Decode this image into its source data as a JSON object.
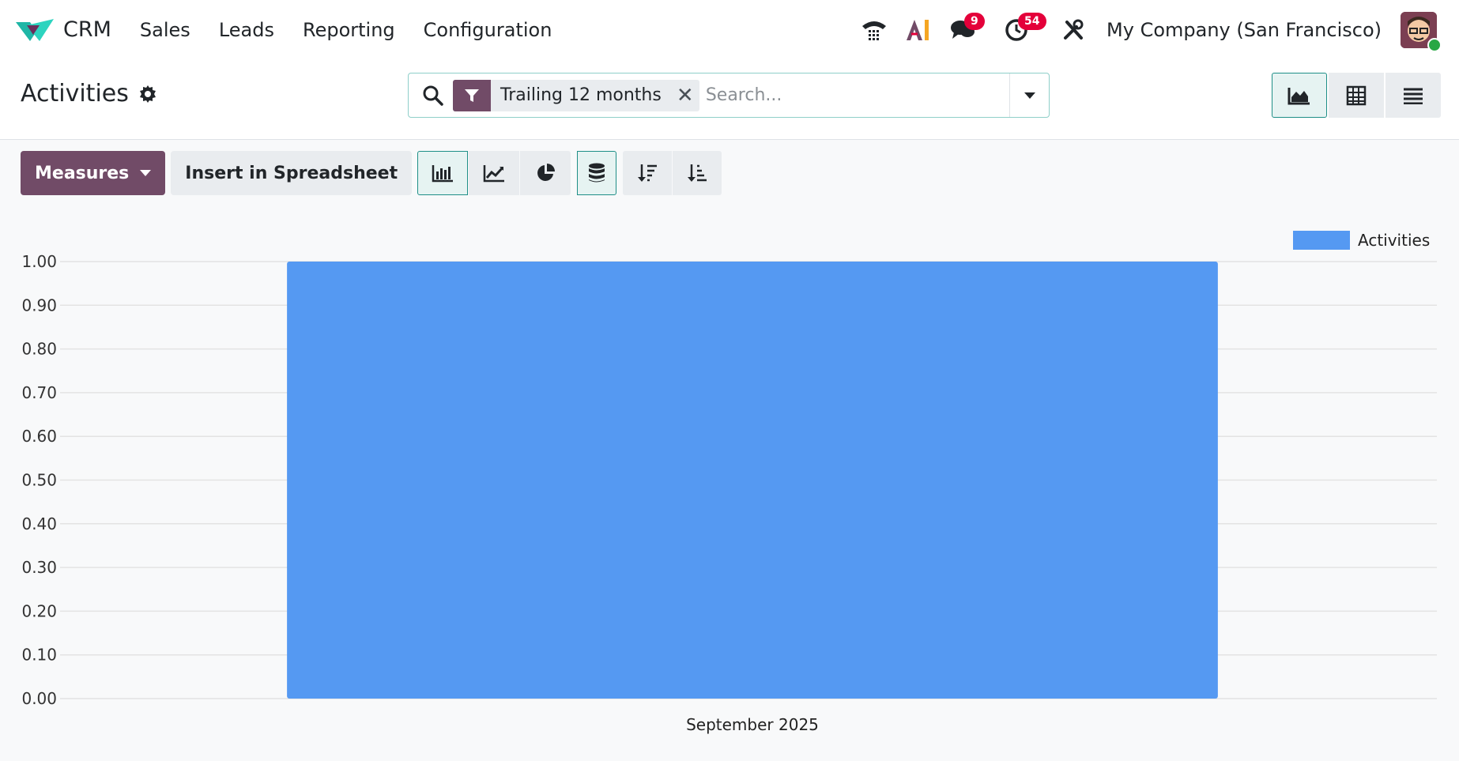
{
  "navbar": {
    "app_name": "CRM",
    "menu": [
      "Sales",
      "Leads",
      "Reporting",
      "Configuration"
    ],
    "messages_badge": "9",
    "activities_badge": "54",
    "company": "My Company (San Francisco)"
  },
  "control": {
    "title": "Activities",
    "facet_label": "Trailing 12 months",
    "search_placeholder": "Search..."
  },
  "toolbar": {
    "measures_label": "Measures",
    "spreadsheet_label": "Insert in Spreadsheet"
  },
  "colors": {
    "brand": "#714b67",
    "bar": "#5599f2",
    "badge": "#e4003a",
    "accent": "#1f8f87"
  },
  "chart_data": {
    "type": "bar",
    "categories": [
      "September 2025"
    ],
    "series": [
      {
        "name": "Activities",
        "values": [
          1.0
        ]
      }
    ],
    "ylim": [
      0,
      1
    ],
    "yticks": [
      "0.00",
      "0.10",
      "0.20",
      "0.30",
      "0.40",
      "0.50",
      "0.60",
      "0.70",
      "0.80",
      "0.90",
      "1.00"
    ],
    "legend": "top-right",
    "grid": true
  }
}
